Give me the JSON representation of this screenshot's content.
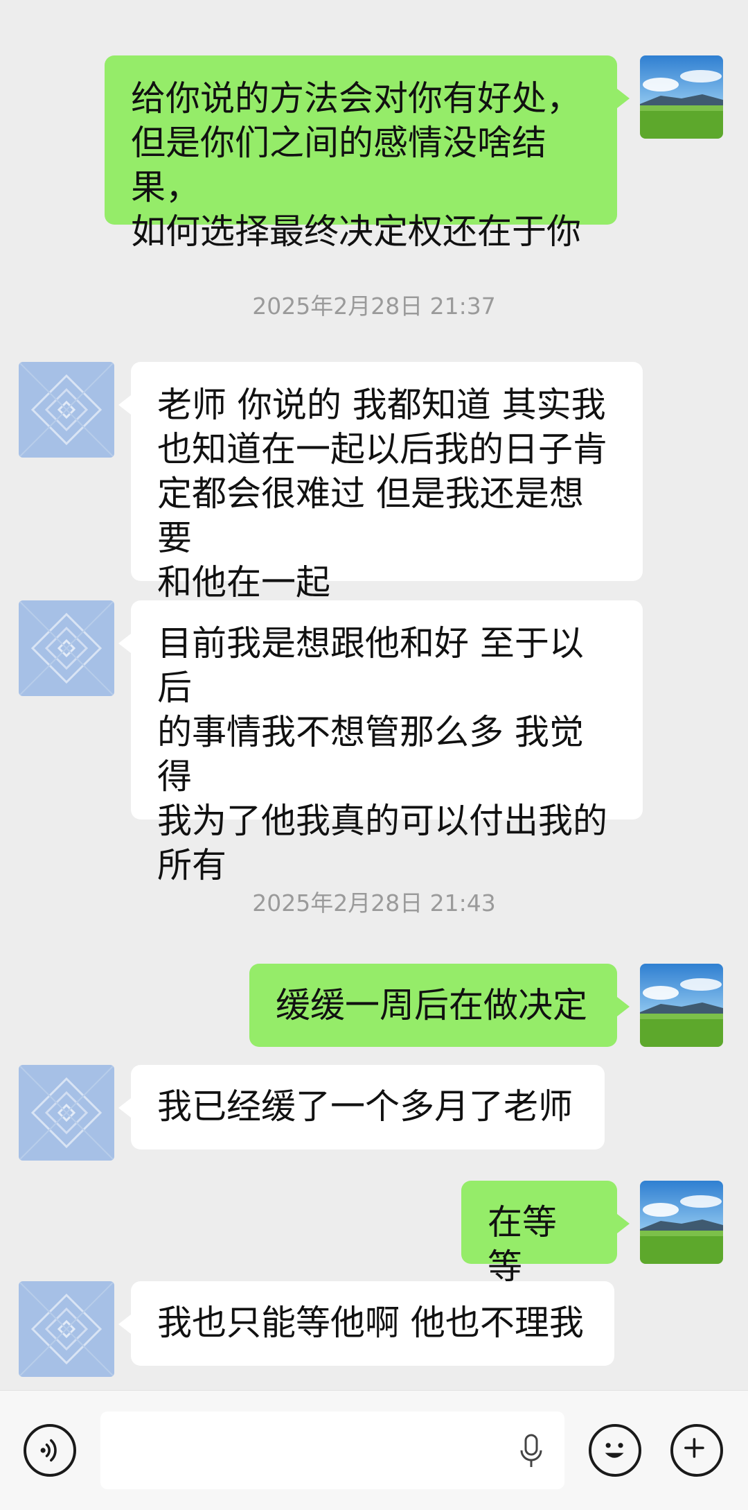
{
  "messages": [
    {
      "side": "out",
      "text": "给你说的方法会对你有好处，\n但是你们之间的感情没啥结果，\n如何选择最终决定权还在于你"
    },
    {
      "side": "in",
      "text": "老师 你说的 我都知道 其实我\n也知道在一起以后我的日子肯\n定都会很难过 但是我还是想要\n和他在一起"
    },
    {
      "side": "in",
      "text": "目前我是想跟他和好 至于以后\n的事情我不想管那么多 我觉得\n我为了他我真的可以付出我的\n所有"
    },
    {
      "side": "out",
      "text": "缓缓一周后在做决定"
    },
    {
      "side": "in",
      "text": "我已经缓了一个多月了老师"
    },
    {
      "side": "out",
      "text": "在等等"
    },
    {
      "side": "in",
      "text": "我也只能等他啊 他也不理我"
    }
  ],
  "timestamps": [
    "2025年2月28日 21:37",
    "2025年2月28日 21:43"
  ],
  "input_bar": {
    "voice_icon": "voice-icon",
    "mic_icon": "microphone-icon",
    "emoji_icon": "emoji-icon",
    "plus_icon": "plus-icon",
    "input_value": ""
  },
  "colors": {
    "background": "#ededed",
    "outgoing_bubble": "#95ec69",
    "incoming_bubble": "#ffffff",
    "timestamp": "#9a9a9a"
  }
}
